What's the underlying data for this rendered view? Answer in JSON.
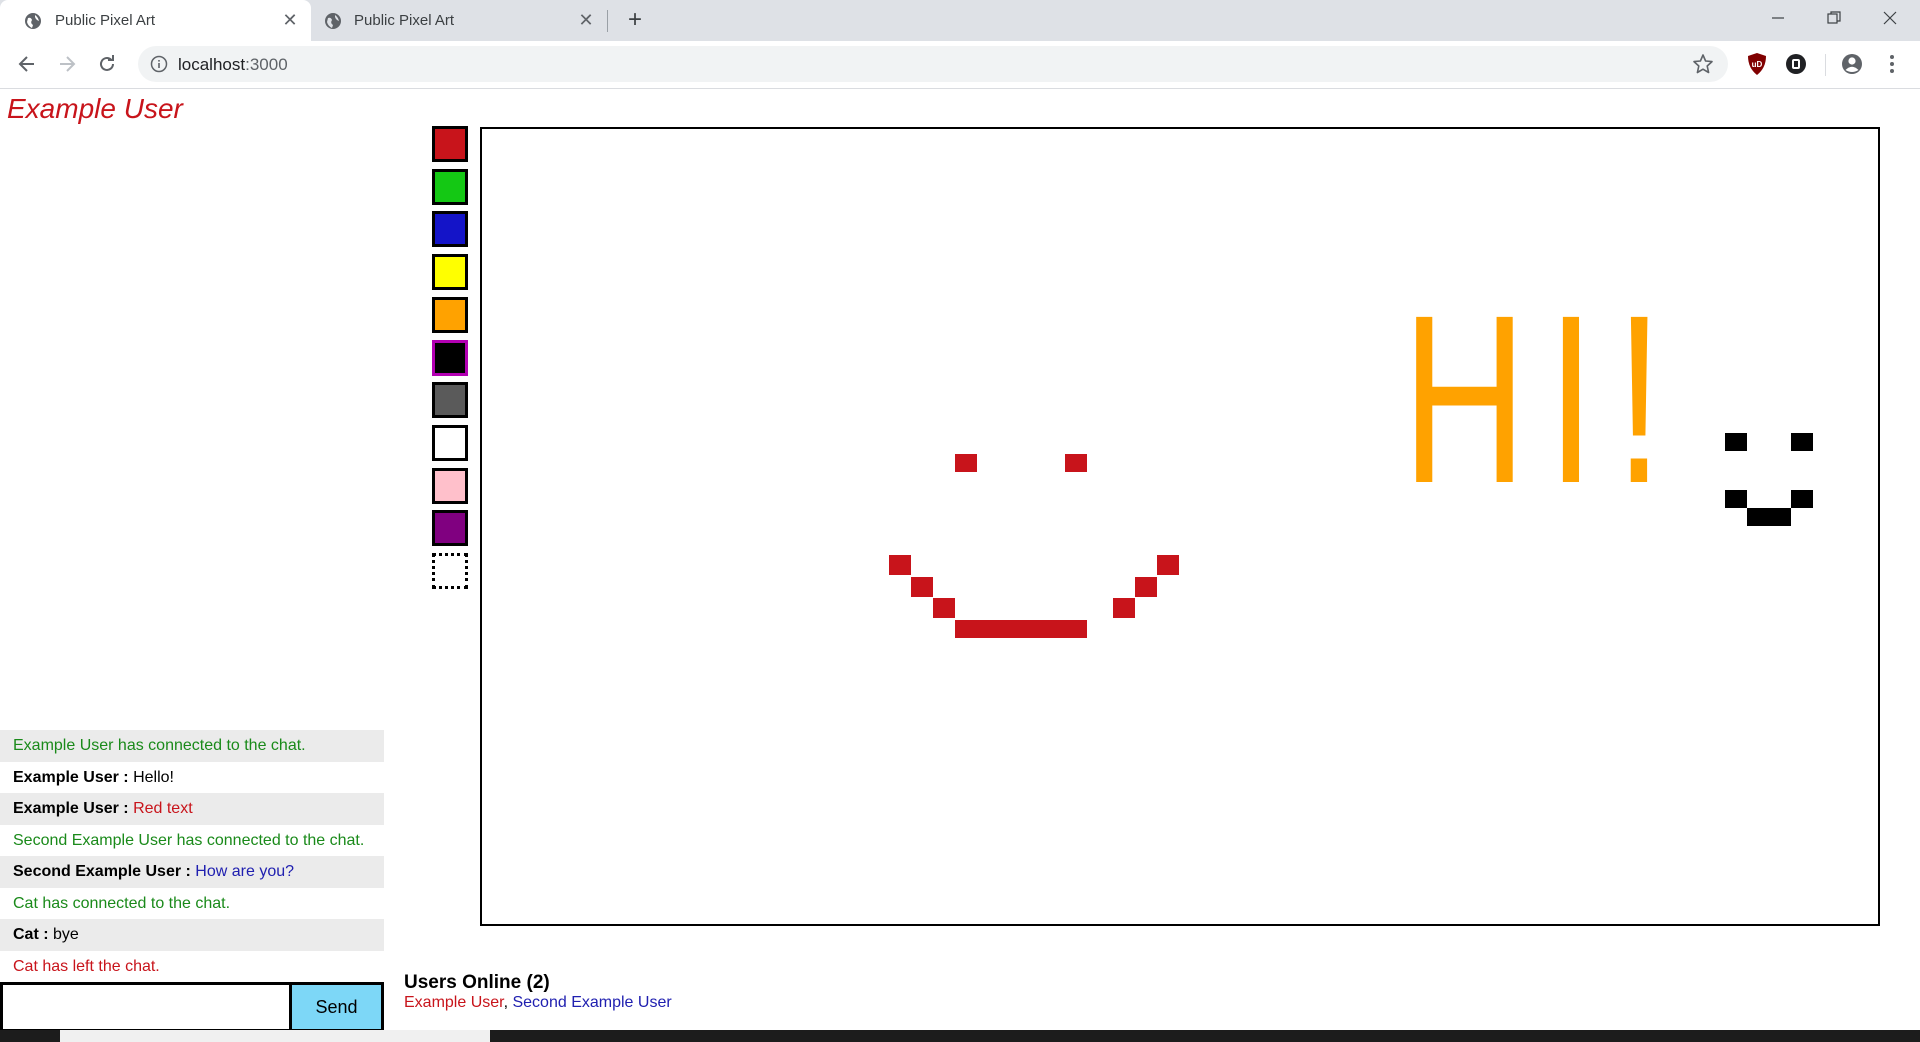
{
  "browser": {
    "tabs": [
      {
        "title": "Public Pixel Art",
        "active": true
      },
      {
        "title": "Public Pixel Art",
        "active": false
      }
    ],
    "url_host": "localhost",
    "url_port": ":3000"
  },
  "app": {
    "username": "Example User",
    "palette": [
      {
        "name": "red",
        "color": "#c8141b"
      },
      {
        "name": "green",
        "color": "#14c814"
      },
      {
        "name": "blue",
        "color": "#1414c8"
      },
      {
        "name": "yellow",
        "color": "#ffff00"
      },
      {
        "name": "orange",
        "color": "#ffa200"
      },
      {
        "name": "black",
        "color": "#000000",
        "selected": true
      },
      {
        "name": "gray",
        "color": "#5a5a5a"
      },
      {
        "name": "white",
        "color": "#ffffff"
      },
      {
        "name": "pink",
        "color": "#ffc0cb"
      },
      {
        "name": "purple",
        "color": "#800080"
      },
      {
        "name": "eraser",
        "color": "transparent"
      }
    ],
    "canvas": {
      "hi_text": "HI!",
      "colors": {
        "smiley_red": "#c8141b",
        "hi_orange": "#ffa200",
        "face_black": "#000000"
      }
    },
    "chat": {
      "messages": [
        {
          "type": "system",
          "text": "Example User has connected to the chat.",
          "color": "#1a8a1a"
        },
        {
          "type": "user",
          "user": "Example User :",
          "text": "Hello!",
          "color": "#000000"
        },
        {
          "type": "user",
          "user": "Example User :",
          "text": "Red text",
          "color": "#c8141b"
        },
        {
          "type": "system",
          "text": "Second Example User has connected to the chat.",
          "color": "#1a8a1a"
        },
        {
          "type": "user",
          "user": "Second Example User :",
          "text": "How are you?",
          "color": "#2020b0"
        },
        {
          "type": "system",
          "text": "Cat has connected to the chat.",
          "color": "#1a8a1a"
        },
        {
          "type": "user",
          "user": "Cat :",
          "text": "bye",
          "color": "#000000"
        },
        {
          "type": "system",
          "text": "Cat has left the chat.",
          "color": "#c8141b"
        }
      ],
      "input_value": "",
      "send_label": "Send"
    },
    "users_online": {
      "title": "Users Online (2)",
      "users": [
        "Example User",
        "Second Example User"
      ],
      "separator": ", "
    }
  }
}
